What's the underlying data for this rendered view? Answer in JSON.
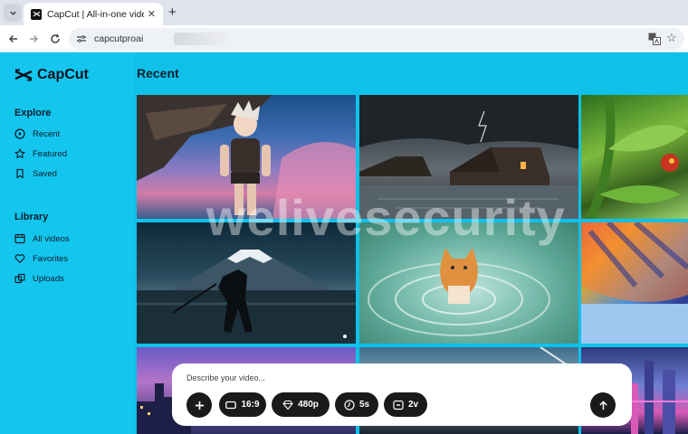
{
  "browser": {
    "tab_title": "CapCut | All-in-one video edito",
    "url": "capcutproai"
  },
  "sidebar": {
    "brand": "CapCut",
    "explore_title": "Explore",
    "explore_items": [
      {
        "label": "Recent",
        "icon": "play-circle-icon"
      },
      {
        "label": "Featured",
        "icon": "star-icon"
      },
      {
        "label": "Saved",
        "icon": "bookmark-icon"
      }
    ],
    "library_title": "Library",
    "library_items": [
      {
        "label": "All videos",
        "icon": "video-grid-icon"
      },
      {
        "label": "Favorites",
        "icon": "heart-icon"
      },
      {
        "label": "Uploads",
        "icon": "uploads-icon"
      }
    ]
  },
  "main": {
    "title": "Recent",
    "watermark": "welivesecurity"
  },
  "prompt": {
    "placeholder": "Describe your video...",
    "aspect": "16:9",
    "resolution": "480p",
    "duration": "5s",
    "version": "2v"
  },
  "colors": {
    "app_background": "#0fc1e9",
    "sidebar_background": "#14c6ee",
    "chip_background": "#1a1a1a"
  }
}
